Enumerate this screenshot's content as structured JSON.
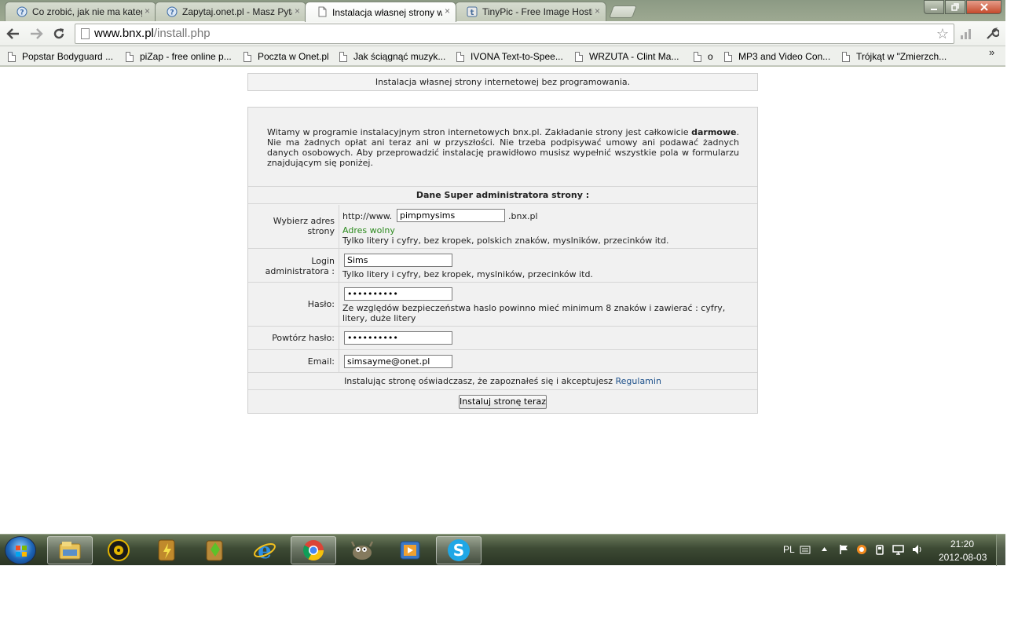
{
  "browser": {
    "tabs": [
      {
        "title": "Co zrobić, jak nie ma kateg",
        "icon": "question-icon",
        "active": false
      },
      {
        "title": "Zapytaj.onet.pl - Masz Pyta",
        "icon": "question-icon",
        "active": false
      },
      {
        "title": "Instalacja własnej strony w",
        "icon": "page-icon",
        "active": true
      },
      {
        "title": "TinyPic - Free Image Hosti",
        "icon": "tinypic-icon",
        "active": false
      }
    ],
    "tab_close_glyph": "×",
    "url_host": "www.bnx.pl",
    "url_path": "/install.php",
    "bookmarks": [
      "Popstar Bodyguard ...",
      "piZap - free online p...",
      "Poczta w Onet.pl",
      "Jak ściągnąć muzyk...",
      "IVONA Text-to-Spee...",
      "WRZUTA - Clint Ma...",
      "o",
      "MP3 and Video Con...",
      "Trójkąt w \"Zmierzch..."
    ],
    "bookmarks_overflow": "»"
  },
  "page": {
    "header": "Instalacja własnej strony internetowej bez programowania.",
    "intro_before": "Witamy w programie instalacyjnym stron internetowych bnx.pl. Zakładanie strony jest całkowicie ",
    "intro_bold": "darmowe",
    "intro_after": ". Nie ma żadnych opłat ani teraz ani w przyszłości. Nie trzeba podpisywać umowy ani podawać żadnych danych osobowych. Aby przeprowadzić instalację prawidłowo musisz wypełnić wszystkie pola w formularzu znajdującym się poniżej.",
    "section_title": "Dane Super administratora strony :",
    "address": {
      "label": "Wybierz adres strony",
      "prefix": "http://www.",
      "value": "pimpmysims",
      "suffix": ".bnx.pl",
      "status": "Adres wolny",
      "hint": "Tylko litery i cyfry, bez kropek, polskich znaków, myslników, przecinków itd."
    },
    "login": {
      "label": "Login administratora :",
      "value": "Sims",
      "hint": "Tylko litery i cyfry, bez kropek, myslników, przecinków itd."
    },
    "password": {
      "label": "Hasło:",
      "value": "••••••••••",
      "hint": "Ze względów bezpieczeństwa haslo powinno mieć minimum 8 znaków i zawierać : cyfry, litery, duże litery"
    },
    "password_repeat": {
      "label": "Powtórz hasło:",
      "value": "••••••••••"
    },
    "email": {
      "label": "Email:",
      "value": "simsayme@onet.pl"
    },
    "terms_text": "Instalując stronę oświadczasz, że zapoznałeś się i akceptujesz ",
    "terms_link": "Regulamin",
    "submit_label": "Instaluj stronę teraz"
  },
  "taskbar": {
    "apps": [
      {
        "name": "explorer-icon",
        "running": true
      },
      {
        "name": "media-player-icon",
        "running": false
      },
      {
        "name": "winamp-icon",
        "running": false
      },
      {
        "name": "sims-game-icon",
        "running": false
      },
      {
        "name": "internet-explorer-icon",
        "running": false
      },
      {
        "name": "chrome-icon",
        "running": true
      },
      {
        "name": "gimp-icon",
        "running": false
      },
      {
        "name": "movie-maker-icon",
        "running": false
      },
      {
        "name": "skype-icon",
        "running": true
      }
    ],
    "language": "PL",
    "time": "21:20",
    "date": "2012-08-03"
  },
  "colors": {
    "status_ok": "#2b8a1d",
    "link": "#1b4f8a",
    "win_close": "#c44a2c",
    "start_orb": "#1c64b5"
  }
}
